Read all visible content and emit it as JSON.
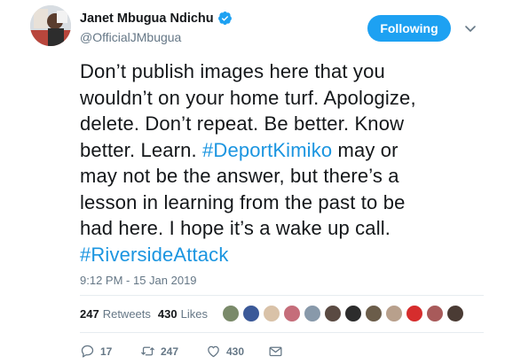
{
  "author": {
    "display_name": "Janet Mbugua Ndichu",
    "handle": "@OfficialJMbugua",
    "verified": true
  },
  "follow_button": {
    "label": "Following"
  },
  "tweet": {
    "lines": [
      [
        {
          "text": "Don’t publish images here that you"
        }
      ],
      [
        {
          "text": "wouldn’t on your home turf. Apologize,"
        }
      ],
      [
        {
          "text": "delete. Don’t repeat. Be better. Know"
        }
      ],
      [
        {
          "text": "better. Learn. "
        },
        {
          "text": "#DeportKimiko",
          "hashtag": true
        },
        {
          "text": " may or"
        }
      ],
      [
        {
          "text": "may not be the answer, but there’s a"
        }
      ],
      [
        {
          "text": "lesson in learning from the past to be"
        }
      ],
      [
        {
          "text": "had here. I hope it’s a wake up call."
        }
      ],
      [
        {
          "text": "#RiversideAttack",
          "hashtag": true
        }
      ]
    ],
    "timestamp": "9:12 PM - 15 Jan 2019"
  },
  "stats": {
    "retweets_count": "247",
    "retweets_label": "Retweets",
    "likes_count": "430",
    "likes_label": "Likes"
  },
  "liker_avatars": [
    {
      "color": "#7a8a6a"
    },
    {
      "color": "#3b5998"
    },
    {
      "color": "#d9c2a8"
    },
    {
      "color": "#c56d7a"
    },
    {
      "color": "#8899aa"
    },
    {
      "color": "#5a4a42"
    },
    {
      "color": "#2c2c2c"
    },
    {
      "color": "#6b5d4a"
    },
    {
      "color": "#b8a08c"
    },
    {
      "color": "#d62d2d"
    },
    {
      "color": "#a85a5a"
    },
    {
      "color": "#4a3b34"
    }
  ],
  "actions": {
    "reply_count": "17",
    "retweet_count": "247",
    "like_count": "430"
  },
  "colors": {
    "brand": "#1da1f2",
    "hashtag": "#1b95e0",
    "secondary_text": "#657786"
  }
}
